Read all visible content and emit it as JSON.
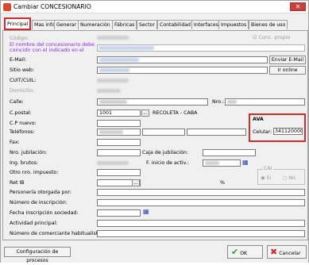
{
  "window": {
    "title": "Cambiar CONCESIONARIO",
    "close_symbol": "✕",
    "icon": "app-icon"
  },
  "tabs": [
    "Principal",
    "Mas info",
    "Generar",
    "Numeración",
    "Fábricas",
    "Sector",
    "Contabilidad",
    "Interfaces",
    "Impuestos",
    "Bienes de uso"
  ],
  "form": {
    "codigo": "Código:",
    "hint1": "El nombre del concesionario debe",
    "hint2": "coincidir con el indicado en el",
    "concprop": "Conc. propio",
    "email": "E-Mail:",
    "enviar": "Enviar E-Mail",
    "sitio": "Sitio web:",
    "ironline": "Ir online",
    "cuit": "CUIT/CUIL:",
    "domicilio": "Domicilio:",
    "calle": "Calle:",
    "nro": "Nro.:",
    "cpostal": "C.postal:",
    "cpostal_val": "1001",
    "ellipsis": "...",
    "localidad": "RECOLETA - CABA",
    "cpnuevo": "C.P nuevo:",
    "telefonos": "Teléfonos:",
    "ava": "AVA",
    "celular": "Celular:",
    "celular_val": "3411200000",
    "fax": "Fax:",
    "jubilacion": "Nro. jubilación:",
    "caja": "Caja de jubilación:",
    "ingbrutos": "Ing. brutos:",
    "finicio": "F. inicio de activ.:",
    "otro": "Otro nro. impuesto:",
    "cai": "CAI",
    "si": "Si",
    "no": "No",
    "retib": "Ret IB",
    "pct": "%",
    "personeria": "Personería otorgada por:",
    "inscripcion": "Número de inscripción:",
    "fechainsc": "Fecha inscripción sociedad:",
    "actividad": "Actividad principal:",
    "comerciante": "Número de comerciante habitualista:"
  },
  "bottom": {
    "config": "Configuración de procesos",
    "ok": "OK",
    "cancel": "Cancelar"
  },
  "colors": {
    "highlight": "#d32a2a",
    "ok": "#2e9d3a",
    "cancel": "#d32a2a"
  }
}
